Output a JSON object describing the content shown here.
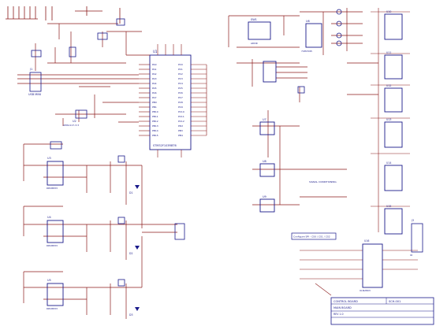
{
  "colors": {
    "wire": "#8b1a1a",
    "part": "#1a1a8a",
    "text": "#1a1a8a",
    "sheet": "#ffffff"
  },
  "main_mcu": {
    "ref": "U1",
    "part_label": "STM32F103RBT6",
    "left_pins": [
      "PA0",
      "PA1",
      "PA2",
      "PA3",
      "PA4",
      "PA5",
      "PA6",
      "PA7",
      "PB0",
      "PB1",
      "PB10",
      "PB11",
      "PB12",
      "PB13",
      "PB14",
      "PB15"
    ],
    "right_pins": [
      "PC0",
      "PC1",
      "PC2",
      "PC3",
      "PC4",
      "PC5",
      "PC6",
      "PC7",
      "PC8",
      "PC9",
      "PC10",
      "PC11",
      "PC12",
      "PD2",
      "PB3",
      "PB4"
    ]
  },
  "usb_connector": {
    "ref": "J1",
    "label": "USB MINI"
  },
  "power_reg": {
    "ref": "U2",
    "label": "AMS1117-3.3"
  },
  "driver_channels": [
    {
      "ref": "U3",
      "label": "DRV8833"
    },
    {
      "ref": "U4",
      "label": "DRV8833"
    },
    {
      "ref": "U5",
      "label": "DRV8833"
    }
  ],
  "leds": [
    "D1",
    "D2",
    "D3"
  ],
  "right_side": {
    "dip_switch": {
      "ref": "SW1",
      "label": "ADDR"
    },
    "mux": {
      "ref": "U6",
      "label": "74HC595"
    },
    "shift_regs": [
      "U10",
      "U11",
      "U12",
      "U13",
      "U14",
      "U15"
    ],
    "adc_parts": [
      "U7",
      "U8",
      "U9"
    ],
    "connector": {
      "ref": "J3",
      "label": "IO"
    }
  },
  "relay_note": "SIGNAL CONDITIONING",
  "ic_bottom": {
    "ref": "U16",
    "label": "ULN2803"
  },
  "notes_box": "Configure SPI - CS0 / CS1 / CS2",
  "title_block": {
    "company": "CONTROL BOARD",
    "title": "MAIN BOARD",
    "rev": "REV 1.0",
    "doc": "SCH-001"
  }
}
